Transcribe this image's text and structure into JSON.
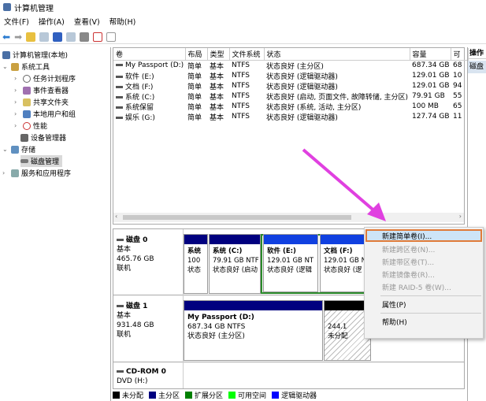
{
  "window": {
    "title": "计算机管理"
  },
  "menu": [
    "文件(F)",
    "操作(A)",
    "查看(V)",
    "帮助(H)"
  ],
  "tree": {
    "root": "计算机管理(本地)",
    "items": [
      "系统工具",
      "任务计划程序",
      "事件查看器",
      "共享文件夹",
      "本地用户和组",
      "性能",
      "设备管理器",
      "存储",
      "磁盘管理",
      "服务和应用程序"
    ]
  },
  "list": {
    "columns": [
      "卷",
      "布局",
      "类型",
      "文件系统",
      "状态",
      "容量",
      "可"
    ],
    "rows": [
      [
        "My Passport (D:)",
        "简单",
        "基本",
        "NTFS",
        "状态良好 (主分区)",
        "687.34 GB",
        "68"
      ],
      [
        "软件 (E:)",
        "简单",
        "基本",
        "NTFS",
        "状态良好 (逻辑驱动器)",
        "129.01 GB",
        "10"
      ],
      [
        "文档 (F:)",
        "简单",
        "基本",
        "NTFS",
        "状态良好 (逻辑驱动器)",
        "129.01 GB",
        "94"
      ],
      [
        "系统 (C:)",
        "简单",
        "基本",
        "NTFS",
        "状态良好 (启动, 页面文件, 故障转储, 主分区)",
        "79.91 GB",
        "55"
      ],
      [
        "系统保留",
        "简单",
        "基本",
        "NTFS",
        "状态良好 (系统, 活动, 主分区)",
        "100 MB",
        "65"
      ],
      [
        "娱乐 (G:)",
        "简单",
        "基本",
        "NTFS",
        "状态良好 (逻辑驱动器)",
        "127.74 GB",
        "11"
      ]
    ]
  },
  "actions": {
    "title": "操作",
    "item": "磁盘"
  },
  "disks": [
    {
      "name": "磁盘 0",
      "type": "基本",
      "size": "465.76 GB",
      "status": "联机",
      "parts": [
        [
          "系统",
          "100",
          "状态"
        ],
        [
          "系统 (C:)",
          "79.91 GB NTF",
          "状态良好 (启动"
        ],
        [
          "软件 (E:)",
          "129.01 GB NT",
          "状态良好 (逻辑"
        ],
        [
          "文档 (F:)",
          "129.01 GB N",
          "状态良好 (逻"
        ]
      ]
    },
    {
      "name": "磁盘 1",
      "type": "基本",
      "size": "931.48 GB",
      "status": "联机",
      "parts": [
        [
          "My Passport (D:)",
          "687.34 GB NTFS",
          "状态良好 (主分区)"
        ],
        [
          "",
          "244.1",
          "未分配"
        ]
      ]
    },
    {
      "name": "CD-ROM 0",
      "type": "DVD (H:)"
    }
  ],
  "legend": [
    {
      "label": "未分配",
      "color": "#000000"
    },
    {
      "label": "主分区",
      "color": "#00007f"
    },
    {
      "label": "扩展分区",
      "color": "#008000"
    },
    {
      "label": "可用空间",
      "color": "#00ff00"
    },
    {
      "label": "逻辑驱动器",
      "color": "#0000ff"
    }
  ],
  "context_menu": [
    "新建简单卷(I)...",
    "新建跨区卷(N)...",
    "新建带区卷(T)...",
    "新建镜像卷(R)...",
    "新建 RAID-5 卷(W)...",
    "属性(P)",
    "帮助(H)"
  ],
  "colors": {
    "highlight": "#e07b39",
    "arrow": "#e040e0"
  }
}
